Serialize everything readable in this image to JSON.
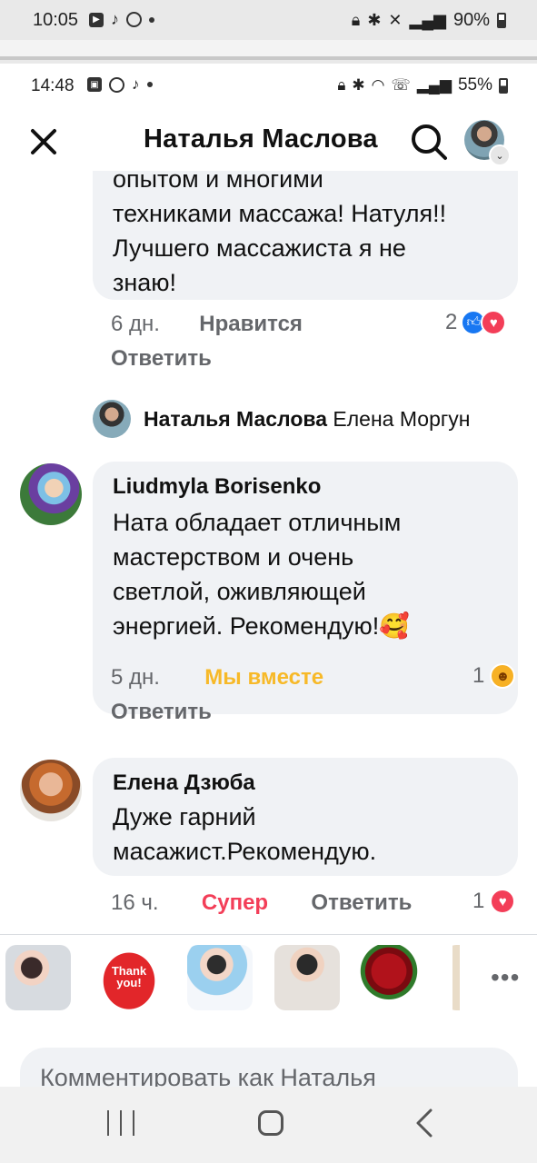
{
  "outer_status": {
    "time": "10:05",
    "battery": "90%"
  },
  "inner_status": {
    "time": "14:48",
    "battery": "55%"
  },
  "header": {
    "title": "Наталья Маслова"
  },
  "comments": [
    {
      "text_lines": [
        "опытом и многими",
        "техниками массажа! Натуля!!",
        "Лучшего массажиста я не",
        "знаю!"
      ],
      "age": "6 дн.",
      "reaction_label": "Нравится",
      "reply_label": "Ответить",
      "reaction_count": "2"
    },
    {
      "author": "Liudmyla Borisenko",
      "text_lines": [
        "Ната обладает отличным",
        "мастерством и очень",
        "светлой,  оживляющей",
        "энергией. Рекомендую!🥰"
      ],
      "age": "5 дн.",
      "reaction_label": "Мы вместе",
      "reply_label": "Ответить",
      "reaction_count": "1"
    },
    {
      "author": "Елена Дзюба",
      "text_lines": [
        "Дуже гарний",
        "масажист.Рекомендую."
      ],
      "age": "16 ч.",
      "reaction_label": "Супер",
      "reply_label": "Ответить",
      "reaction_count": "1"
    }
  ],
  "reply_line": {
    "author": "Наталья Маслова",
    "mention": "Елена Моргун"
  },
  "stickers": {
    "thank_you_line1": "Thank",
    "thank_you_line2": "you!",
    "more": "•••"
  },
  "composer": {
    "placeholder": "Комментировать как Наталья"
  },
  "colors": {
    "like": "#1877f2",
    "love": "#f33e58",
    "care": "#f7b125",
    "bubble": "#f0f2f5",
    "meta": "#65676b",
    "together": "#f7b928",
    "super": "#f33e58"
  }
}
